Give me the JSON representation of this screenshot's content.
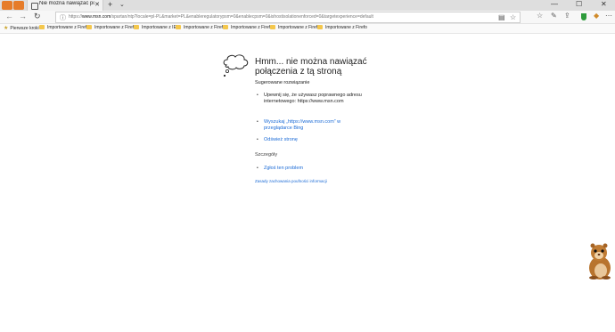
{
  "tab": {
    "title": "Nie można nawiązać po",
    "close": "✕"
  },
  "tabbar": {
    "new_tab": "+",
    "menu": "⌄",
    "minimize": "—",
    "maximize": "☐",
    "close": "✕"
  },
  "nav": {
    "back": "←",
    "forward": "→",
    "refresh": "↻",
    "url_prefix": "https://",
    "url_host": "www.msn.com",
    "url_rest": "/spartan/ntp?locale=pl-PL&market=PL&enableregulatorypsm=0&enablecpsm=0&ishostisolationenforced=0&targetexperience=default",
    "reading_icon": "▤",
    "favorite_icon": "☆",
    "favorites_hub": "☆",
    "pen": "✎",
    "share": "⇪",
    "more": "⋯"
  },
  "favorites": [
    {
      "label": "Pierwsze kroki",
      "type": "star"
    },
    {
      "label": "Importowane z Firefo",
      "type": "folder"
    },
    {
      "label": "Importowane z Firefo",
      "type": "folder"
    },
    {
      "label": "Importowane z IE",
      "type": "folder"
    },
    {
      "label": "Importowane z Firefo",
      "type": "folder"
    },
    {
      "label": "Importowane z Firefo",
      "type": "folder"
    },
    {
      "label": "Importowane z Firefo",
      "type": "folder"
    },
    {
      "label": "Importowane z Firefo",
      "type": "folder"
    }
  ],
  "error": {
    "title": "Hmm... nie można nawiązać połączenia z tą stroną",
    "suggested_heading": "Sugerowane rozwiązanie",
    "items": [
      {
        "text": "Upewnij się, że używasz poprawnego adresu internetowego: https://www.msn.com",
        "link": false
      },
      {
        "text": "Wyszukaj „https://www.msn.com” w przeglądarce Bing",
        "link": true
      },
      {
        "text": "Odśwież stronę",
        "link": true
      }
    ],
    "details_heading": "Szczegóły",
    "report_link": "Zgłoś ten problem",
    "privacy_link": "Zasady zachowania poufności informacji"
  }
}
